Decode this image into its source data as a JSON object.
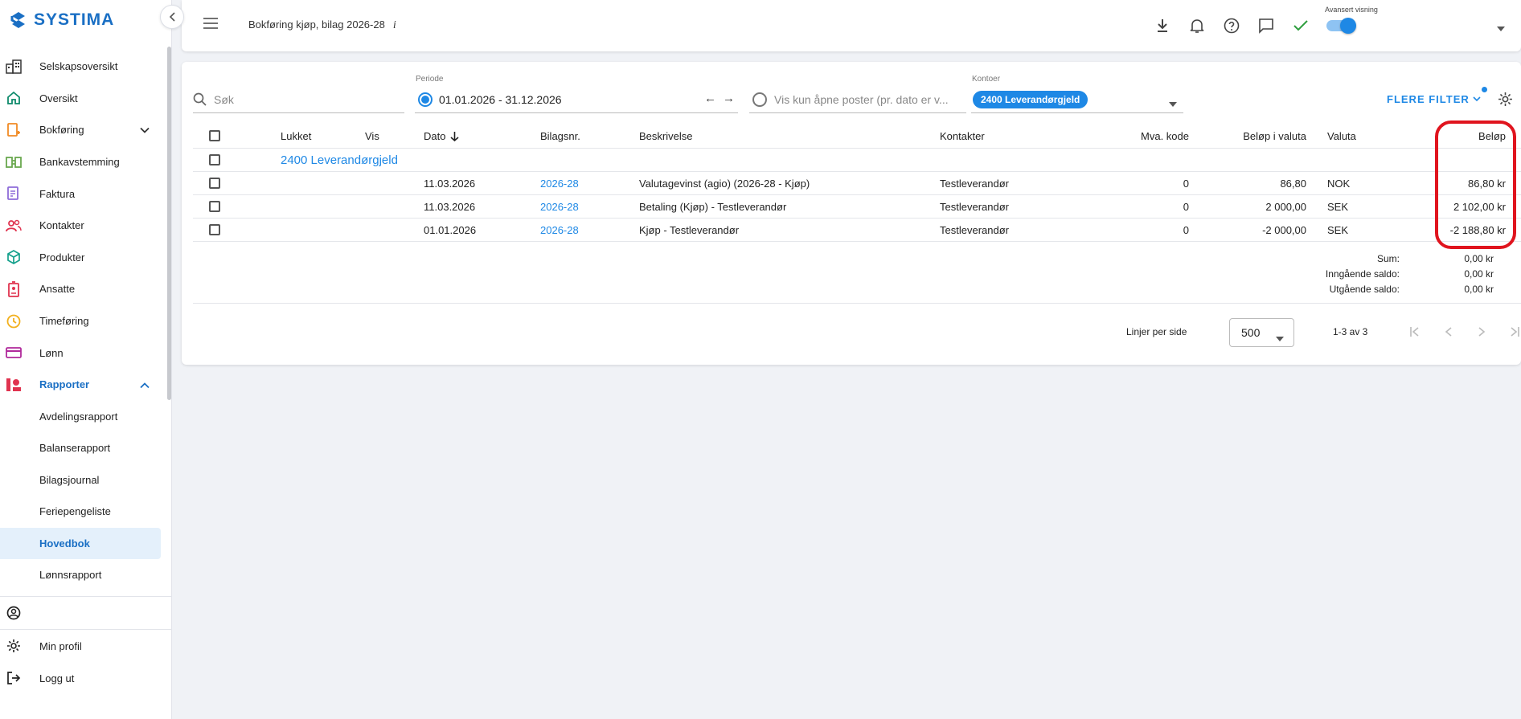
{
  "app": {
    "logo_text": "SYSTIMA"
  },
  "sidebar": {
    "items": [
      {
        "label": "Selskapsoversikt"
      },
      {
        "label": "Oversikt"
      },
      {
        "label": "Bokføring"
      },
      {
        "label": "Bankavstemming"
      },
      {
        "label": "Faktura"
      },
      {
        "label": "Kontakter"
      },
      {
        "label": "Produkter"
      },
      {
        "label": "Ansatte"
      },
      {
        "label": "Timeføring"
      },
      {
        "label": "Lønn"
      },
      {
        "label": "Rapporter"
      }
    ],
    "subitems": [
      {
        "label": "Avdelingsrapport"
      },
      {
        "label": "Balanserapport"
      },
      {
        "label": "Bilagsjournal"
      },
      {
        "label": "Feriepengeliste"
      },
      {
        "label": "Hovedbok"
      },
      {
        "label": "Lønnsrapport"
      }
    ],
    "bottom": {
      "profile": "Min profil",
      "logout": "Logg ut"
    }
  },
  "topbar": {
    "title": "Bokføring kjøp, bilag 2026-28",
    "info": "i",
    "advanced_label": "Avansert visning"
  },
  "filters": {
    "search_placeholder": "Søk",
    "period_label": "Periode",
    "period_value": "01.01.2026 - 31.12.2026",
    "open_posts_placeholder": "Vis kun åpne poster (pr. dato er v...",
    "accounts_label": "Kontoer",
    "account_chip": "2400 Leverandørgjeld",
    "more_filters": "FLERE FILTER"
  },
  "table": {
    "headers": {
      "lukket": "Lukket",
      "vis": "Vis",
      "dato": "Dato",
      "bilagsnr": "Bilagsnr.",
      "beskrivelse": "Beskrivelse",
      "kontakter": "Kontakter",
      "mva": "Mva. kode",
      "belop_valuta": "Beløp i valuta",
      "valuta": "Valuta",
      "belop": "Beløp"
    },
    "group": "2400 Leverandørgjeld",
    "rows": [
      {
        "dato": "11.03.2026",
        "bilagsnr": "2026-28",
        "beskrivelse": "Valutagevinst (agio) (2026-28 - Kjøp)",
        "kontakter": "Testleverandør",
        "mva": "0",
        "belop_valuta": "86,80",
        "valuta": "NOK",
        "belop": "86,80 kr"
      },
      {
        "dato": "11.03.2026",
        "bilagsnr": "2026-28",
        "beskrivelse": "Betaling (Kjøp) - Testleverandør",
        "kontakter": "Testleverandør",
        "mva": "0",
        "belop_valuta": "2 000,00",
        "valuta": "SEK",
        "belop": "2 102,00 kr"
      },
      {
        "dato": "01.01.2026",
        "bilagsnr": "2026-28",
        "beskrivelse": "Kjøp - Testleverandør",
        "kontakter": "Testleverandør",
        "mva": "0",
        "belop_valuta": "-2 000,00",
        "valuta": "SEK",
        "belop": "-2 188,80 kr"
      }
    ]
  },
  "summary": {
    "sum_label": "Sum:",
    "sum_value": "0,00 kr",
    "in_label": "Inngående saldo:",
    "in_value": "0,00 kr",
    "out_label": "Utgående saldo:",
    "out_value": "0,00 kr"
  },
  "pagination": {
    "rows_per_page_label": "Linjer per side",
    "rows_per_page": "500",
    "range": "1-3 av 3"
  },
  "colors": {
    "accent": "#1e88e5",
    "highlight": "#e0141e",
    "brand": "#1a6fc4"
  }
}
